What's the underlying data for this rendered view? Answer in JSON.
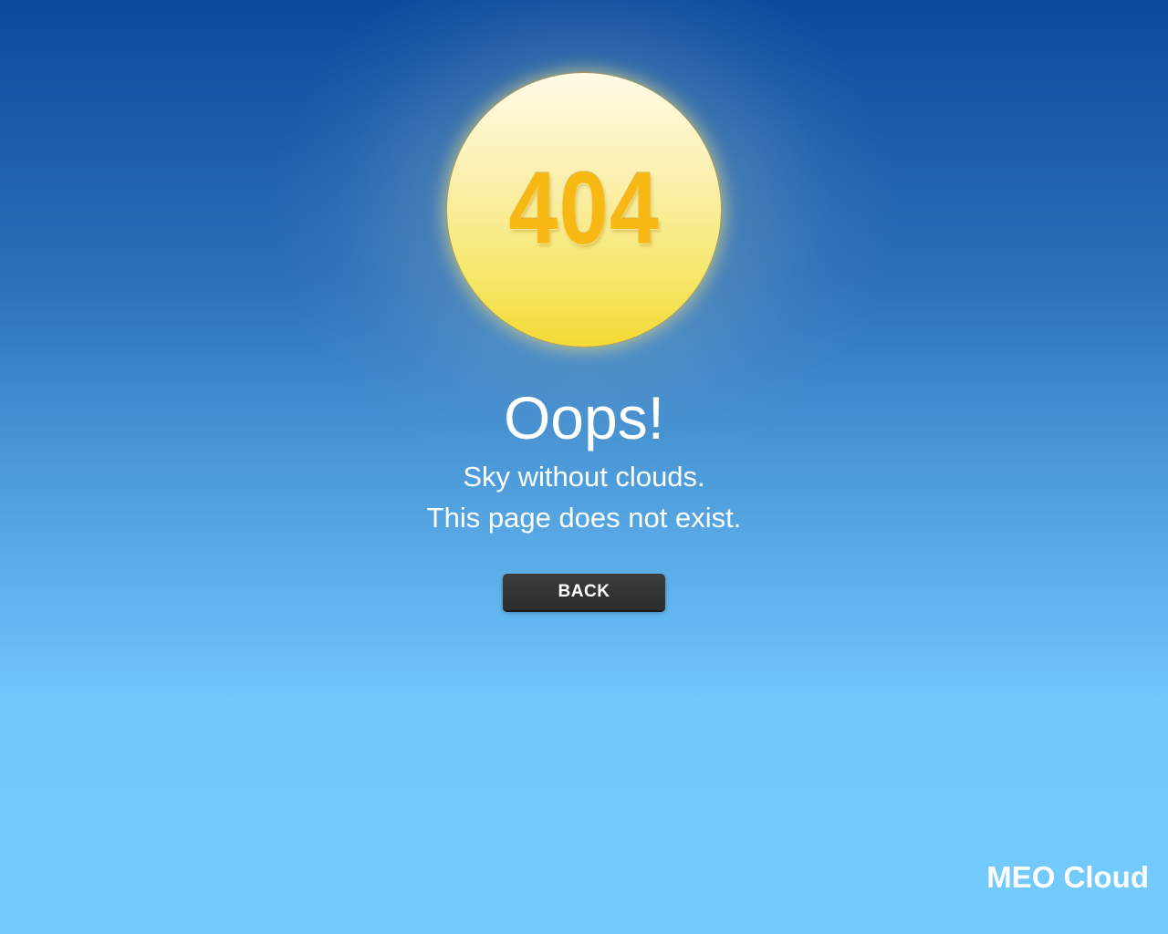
{
  "error": {
    "code": "404",
    "title": "Oops!",
    "message_line1": "Sky without clouds.",
    "message_line2": "This page does not exist."
  },
  "actions": {
    "back_label": "BACK"
  },
  "brand": {
    "name": "MEO Cloud"
  },
  "colors": {
    "sky_top": "#0b4a9c",
    "sky_bottom": "#72cafd",
    "sun": "#f3da34",
    "code_text": "#f8b814",
    "button": "#2d2d2d"
  },
  "icons": {
    "sun": "sun-icon"
  }
}
